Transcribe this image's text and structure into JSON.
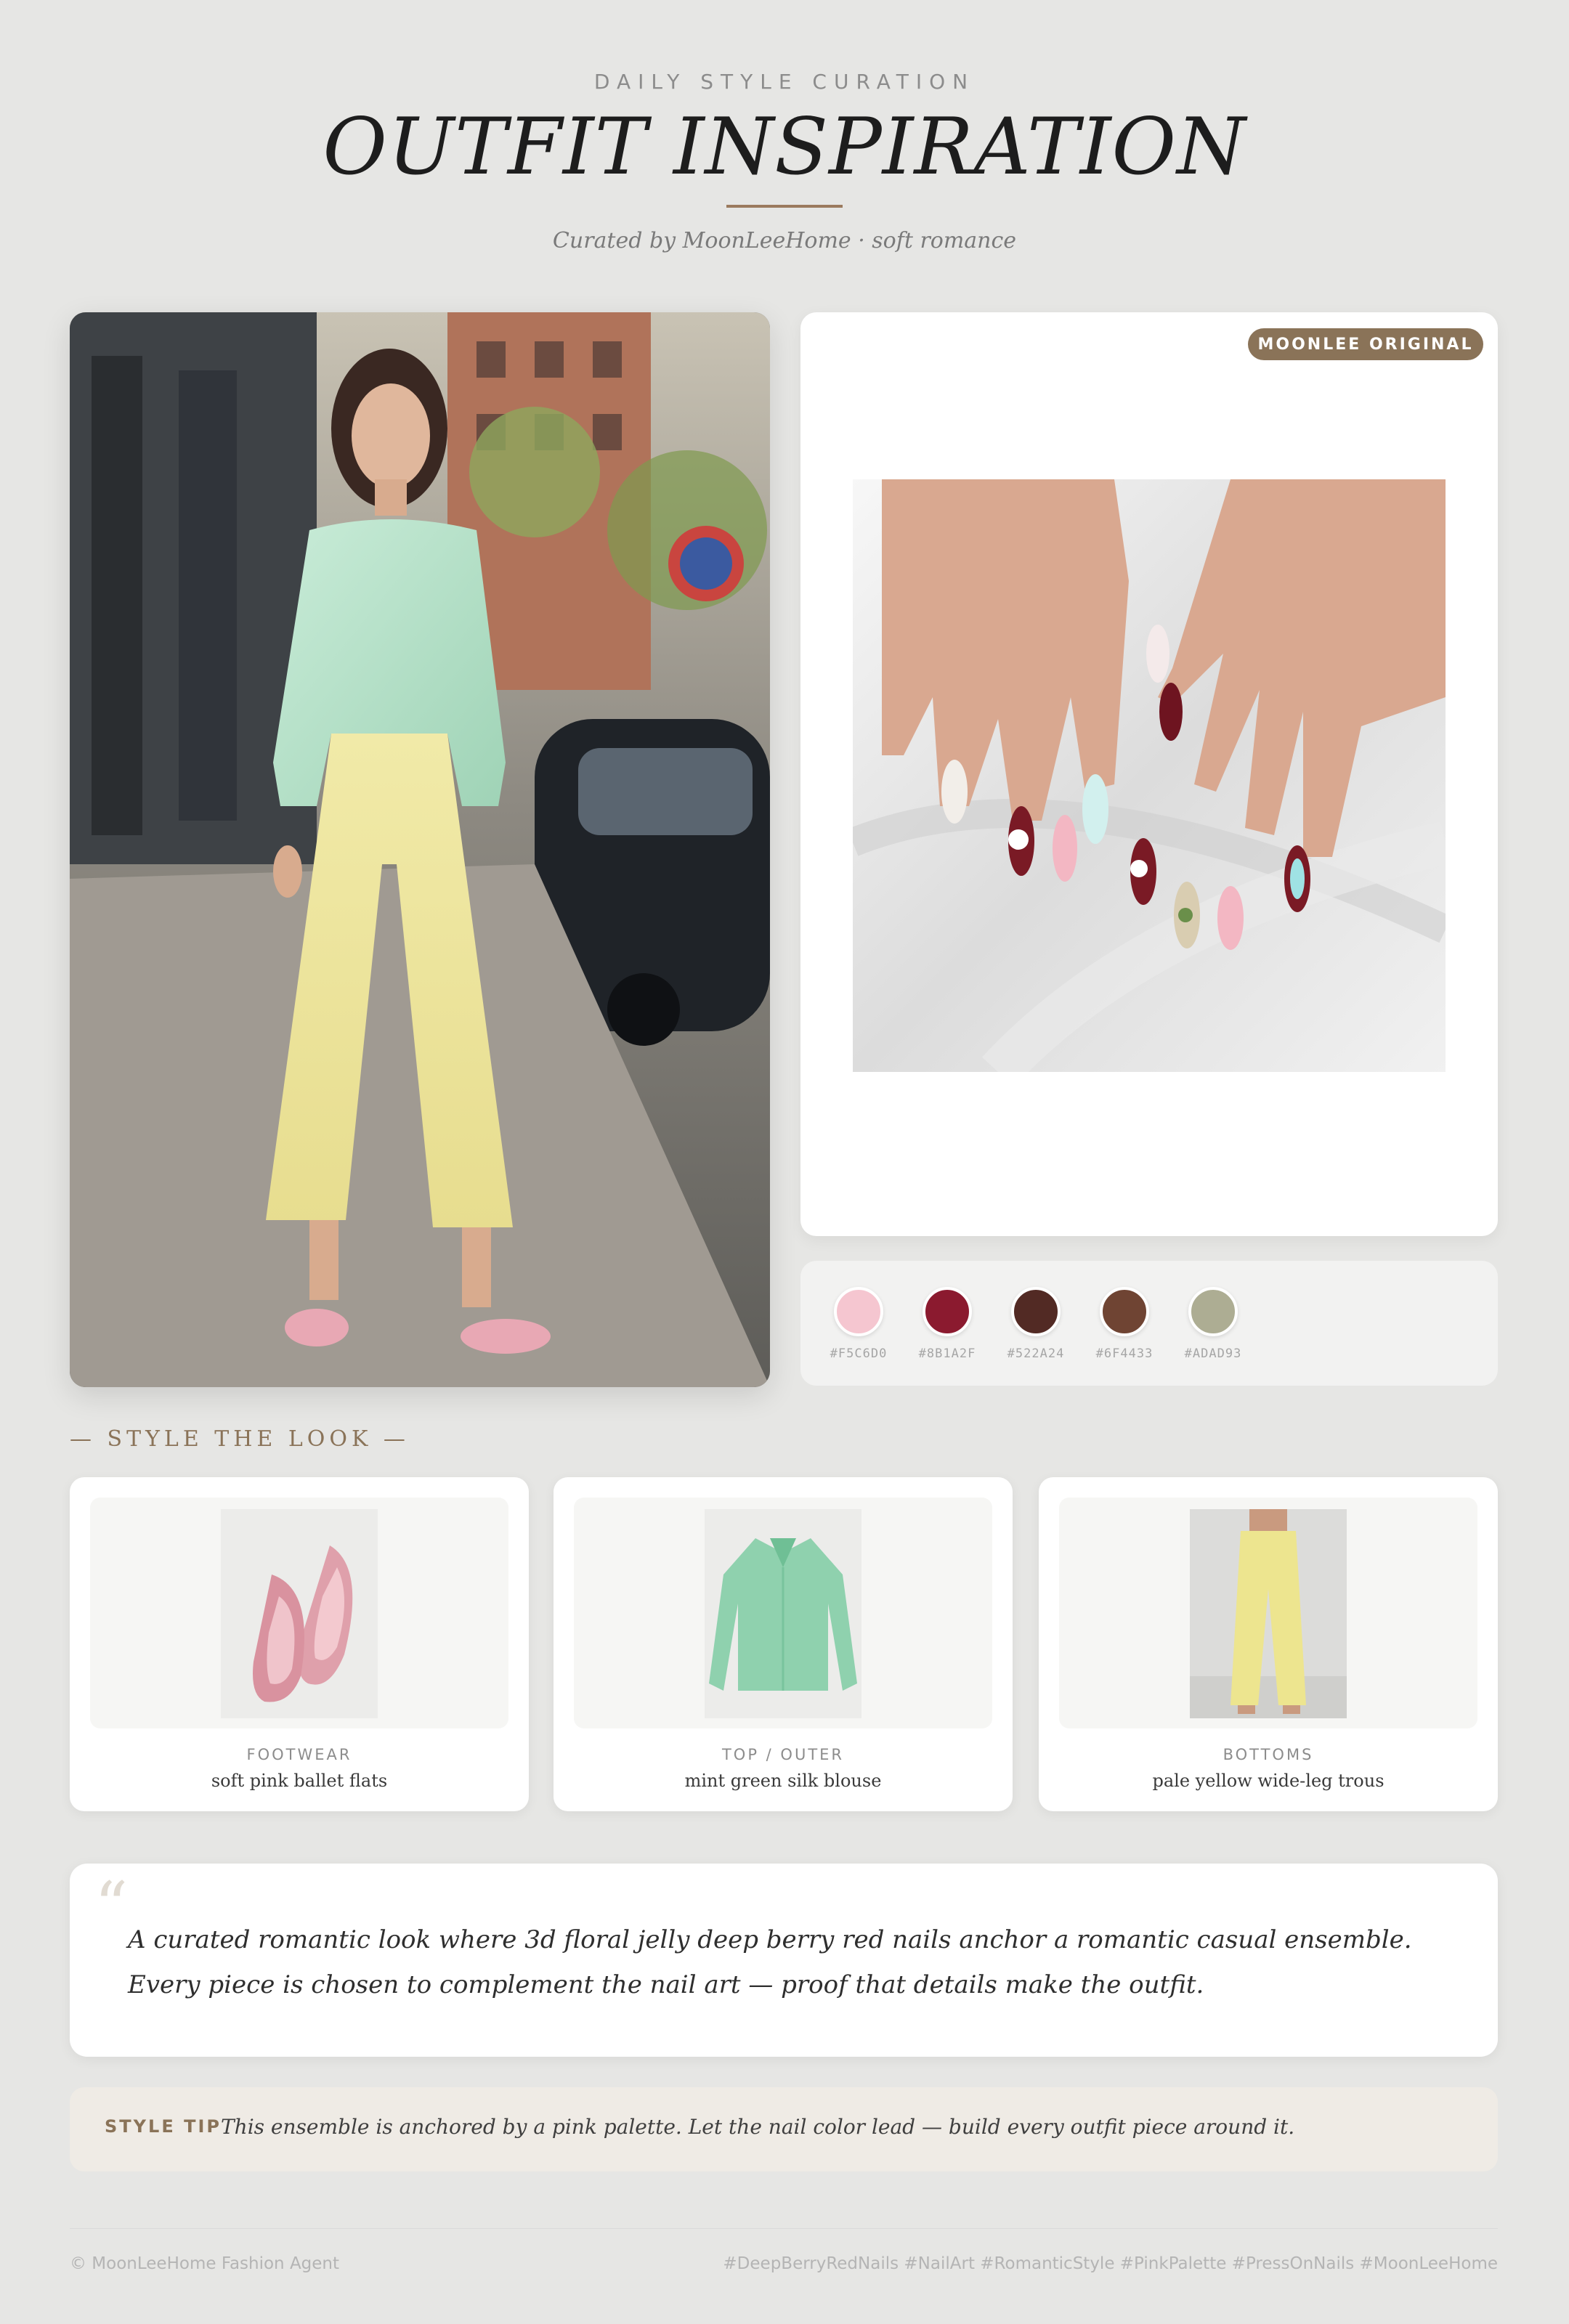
{
  "header": {
    "eyebrow": "DAILY STYLE CURATION",
    "title": "OUTFIT INSPIRATION",
    "subtitle": "Curated by MoonLeeHome · soft romance"
  },
  "nails": {
    "badge": "MOONLEE ORIGINAL"
  },
  "palette": [
    {
      "hex": "#F5C6D0",
      "color": "#F5C6D0"
    },
    {
      "hex": "#8B1A2F",
      "color": "#8B1A2F"
    },
    {
      "hex": "#522A24",
      "color": "#522A24"
    },
    {
      "hex": "#6F4433",
      "color": "#6F4433"
    },
    {
      "hex": "#ADAD93",
      "color": "#ADAD93"
    }
  ],
  "look": {
    "section_label": "— STYLE THE LOOK —",
    "items": [
      {
        "category": "FOOTWEAR",
        "description": "soft pink ballet flats",
        "icon": "ballet-flats-icon"
      },
      {
        "category": "TOP / OUTER",
        "description": "mint green silk blouse",
        "icon": "blouse-icon"
      },
      {
        "category": "BOTTOMS",
        "description": "pale yellow wide-leg trous",
        "icon": "trousers-icon"
      }
    ]
  },
  "quote": {
    "mark": "“",
    "text": "A curated romantic look where 3d floral jelly deep berry red nails anchor a romantic casual ensemble. Every piece is chosen to complement the nail art — proof that details make the outfit."
  },
  "tip": {
    "label": "STYLE TIP",
    "text": "This ensemble is anchored by a pink palette. Let the nail color lead — build every outfit piece around it."
  },
  "footer": {
    "left": "© MoonLeeHome Fashion Agent",
    "right": "#DeepBerryRedNails #NailArt #RomanticStyle #PinkPalette #PressOnNails #MoonLeeHome"
  }
}
